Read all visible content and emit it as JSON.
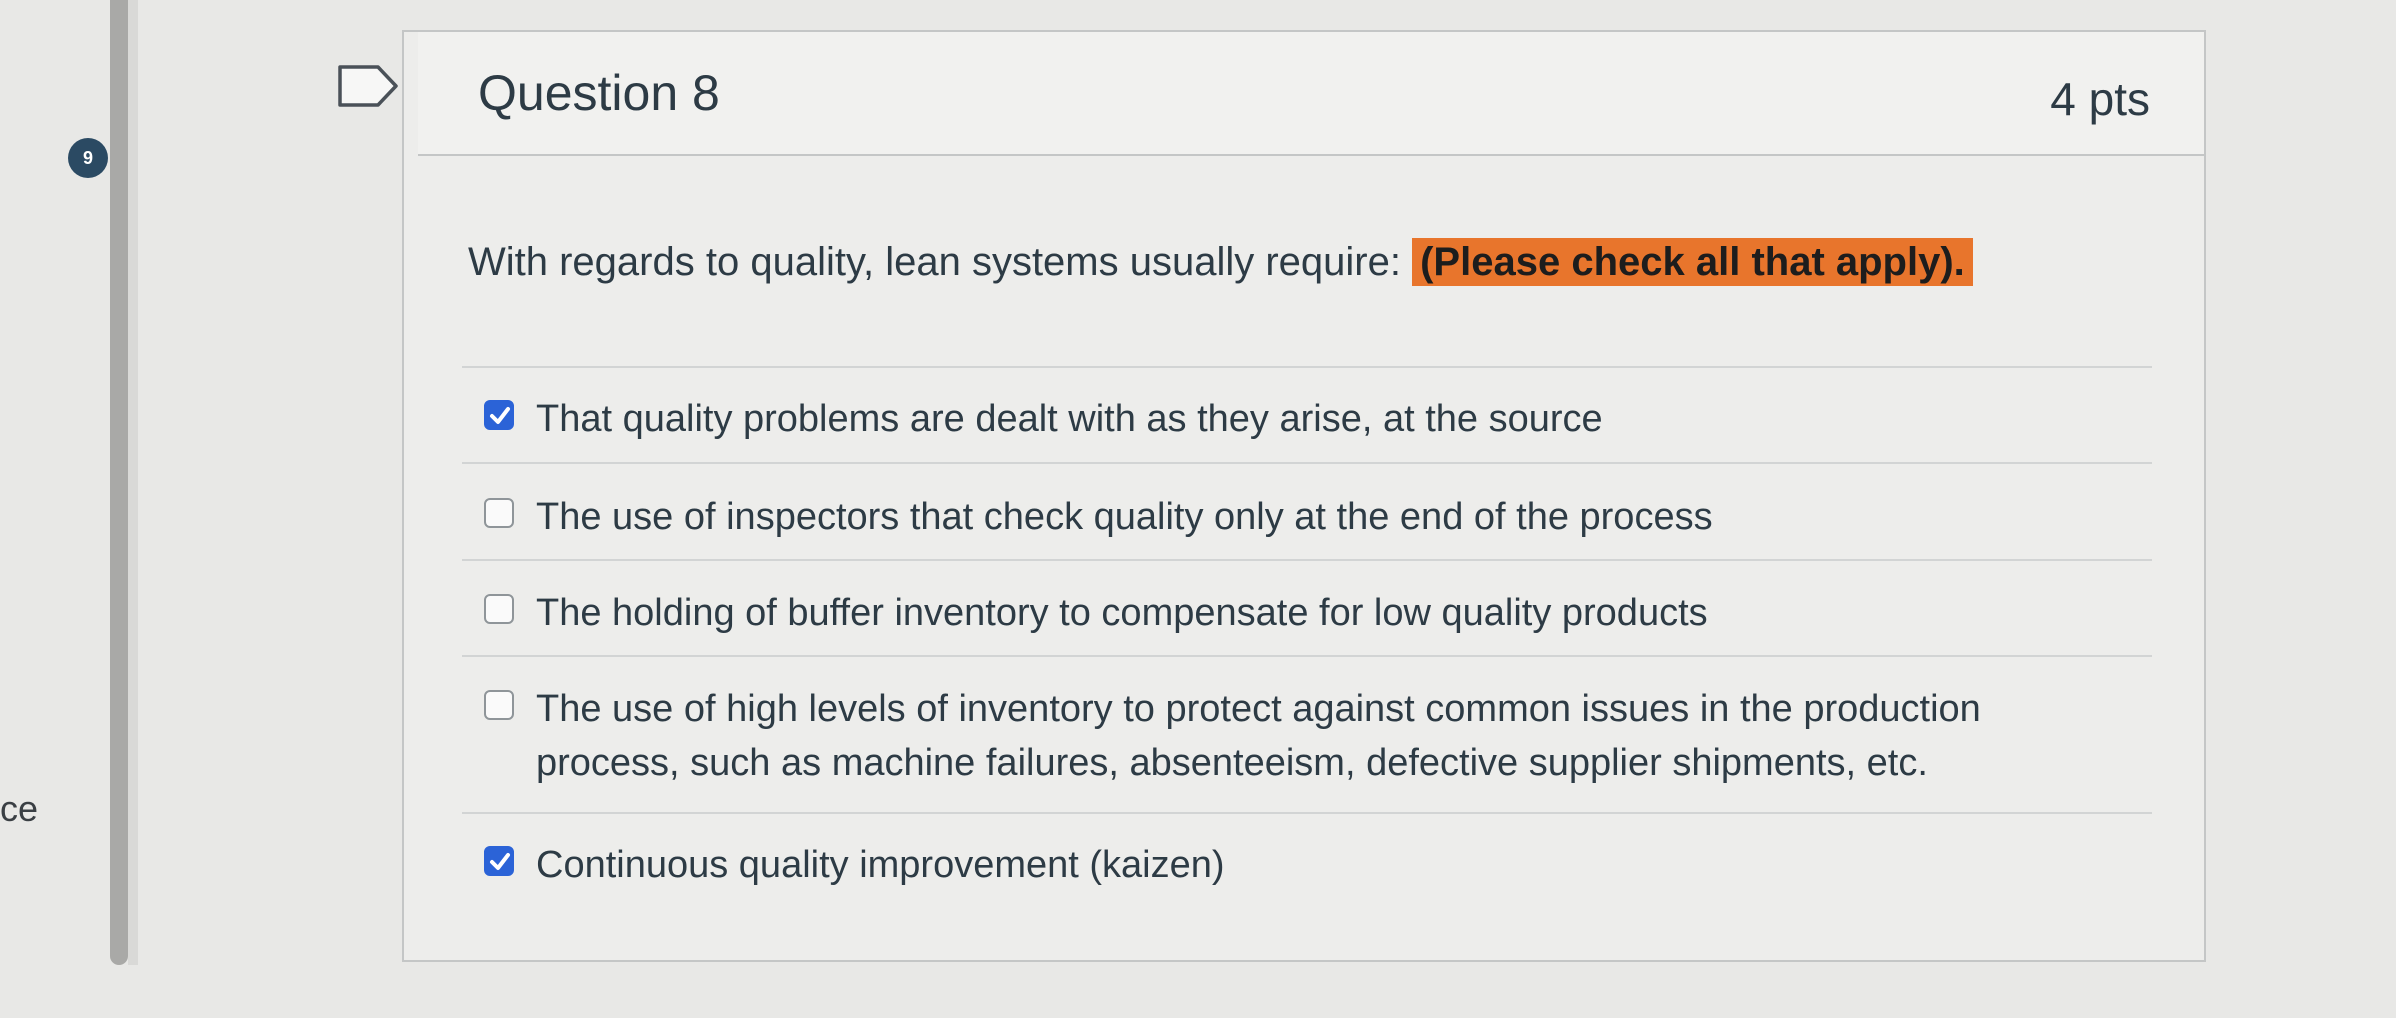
{
  "sidebar": {
    "question_number": "9",
    "edge_text": "ce"
  },
  "question": {
    "title": "Question 8",
    "points": "4 pts",
    "prompt": "With regards to quality, lean systems usually require: ",
    "prompt_highlight": "(Please check all that apply).",
    "highlight_color": "#e8752c"
  },
  "answers": [
    {
      "label": "That quality problems are dealt with as they arise, at the source",
      "checked": true
    },
    {
      "label": "The use of inspectors that check quality only at the end of the process",
      "checked": false
    },
    {
      "label": "The holding of buffer inventory to compensate for low quality products",
      "checked": false
    },
    {
      "label": "The use of high levels of inventory to protect against common issues in the production process, such as machine failures, absenteeism, defective supplier shipments, etc.",
      "checked": false
    },
    {
      "label": "Continuous quality improvement (kaizen)",
      "checked": true
    }
  ],
  "colors": {
    "checkbox_checked": "#2b63d7",
    "text": "#2d3b45"
  },
  "icons": {
    "flag": "flag-bookmark-icon",
    "check": "checkmark-icon"
  }
}
